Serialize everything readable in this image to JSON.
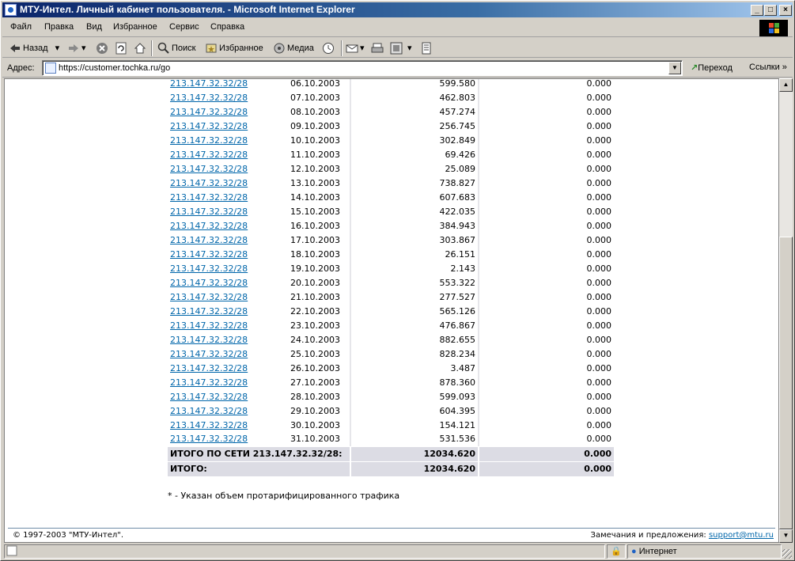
{
  "window": {
    "title": "МТУ-Интел. Личный кабинет пользователя. - Microsoft Internet Explorer",
    "min": "_",
    "max": "□",
    "close": "×"
  },
  "menu": {
    "file": "Файл",
    "edit": "Правка",
    "view": "Вид",
    "favorites": "Избранное",
    "tools": "Сервис",
    "help": "Справка"
  },
  "toolbar": {
    "back": "Назад",
    "search": "Поиск",
    "favorites": "Избранное",
    "media": "Медиа"
  },
  "address": {
    "label": "Адрес:",
    "url": "https://customer.tochka.ru/go",
    "go": "Переход",
    "links": "Ссылки"
  },
  "table": {
    "rows": [
      {
        "net": "213.147.32.32/28",
        "date": "06.10.2003",
        "in": "599.580",
        "out": "0.000"
      },
      {
        "net": "213.147.32.32/28",
        "date": "07.10.2003",
        "in": "462.803",
        "out": "0.000"
      },
      {
        "net": "213.147.32.32/28",
        "date": "08.10.2003",
        "in": "457.274",
        "out": "0.000"
      },
      {
        "net": "213.147.32.32/28",
        "date": "09.10.2003",
        "in": "256.745",
        "out": "0.000"
      },
      {
        "net": "213.147.32.32/28",
        "date": "10.10.2003",
        "in": "302.849",
        "out": "0.000"
      },
      {
        "net": "213.147.32.32/28",
        "date": "11.10.2003",
        "in": "69.426",
        "out": "0.000"
      },
      {
        "net": "213.147.32.32/28",
        "date": "12.10.2003",
        "in": "25.089",
        "out": "0.000"
      },
      {
        "net": "213.147.32.32/28",
        "date": "13.10.2003",
        "in": "738.827",
        "out": "0.000"
      },
      {
        "net": "213.147.32.32/28",
        "date": "14.10.2003",
        "in": "607.683",
        "out": "0.000"
      },
      {
        "net": "213.147.32.32/28",
        "date": "15.10.2003",
        "in": "422.035",
        "out": "0.000"
      },
      {
        "net": "213.147.32.32/28",
        "date": "16.10.2003",
        "in": "384.943",
        "out": "0.000"
      },
      {
        "net": "213.147.32.32/28",
        "date": "17.10.2003",
        "in": "303.867",
        "out": "0.000"
      },
      {
        "net": "213.147.32.32/28",
        "date": "18.10.2003",
        "in": "26.151",
        "out": "0.000"
      },
      {
        "net": "213.147.32.32/28",
        "date": "19.10.2003",
        "in": "2.143",
        "out": "0.000"
      },
      {
        "net": "213.147.32.32/28",
        "date": "20.10.2003",
        "in": "553.322",
        "out": "0.000"
      },
      {
        "net": "213.147.32.32/28",
        "date": "21.10.2003",
        "in": "277.527",
        "out": "0.000"
      },
      {
        "net": "213.147.32.32/28",
        "date": "22.10.2003",
        "in": "565.126",
        "out": "0.000"
      },
      {
        "net": "213.147.32.32/28",
        "date": "23.10.2003",
        "in": "476.867",
        "out": "0.000"
      },
      {
        "net": "213.147.32.32/28",
        "date": "24.10.2003",
        "in": "882.655",
        "out": "0.000"
      },
      {
        "net": "213.147.32.32/28",
        "date": "25.10.2003",
        "in": "828.234",
        "out": "0.000"
      },
      {
        "net": "213.147.32.32/28",
        "date": "26.10.2003",
        "in": "3.487",
        "out": "0.000"
      },
      {
        "net": "213.147.32.32/28",
        "date": "27.10.2003",
        "in": "878.360",
        "out": "0.000"
      },
      {
        "net": "213.147.32.32/28",
        "date": "28.10.2003",
        "in": "599.093",
        "out": "0.000"
      },
      {
        "net": "213.147.32.32/28",
        "date": "29.10.2003",
        "in": "604.395",
        "out": "0.000"
      },
      {
        "net": "213.147.32.32/28",
        "date": "30.10.2003",
        "in": "154.121",
        "out": "0.000"
      },
      {
        "net": "213.147.32.32/28",
        "date": "31.10.2003",
        "in": "531.536",
        "out": "0.000"
      }
    ],
    "net_total": {
      "label": "ИТОГО ПО СЕТИ 213.147.32.32/28:",
      "in": "12034.620",
      "out": "0.000"
    },
    "grand_total": {
      "label": "ИТОГО:",
      "in": "12034.620",
      "out": "0.000"
    }
  },
  "footnote": "* - Указан объем протарифицированного трафика",
  "footer": {
    "copyright": "© 1997-2003 \"МТУ-Интел\".",
    "feedback_label": "Замечания и предложения:",
    "feedback_email": "support@mtu.ru"
  },
  "status": {
    "zone": "Интернет"
  }
}
